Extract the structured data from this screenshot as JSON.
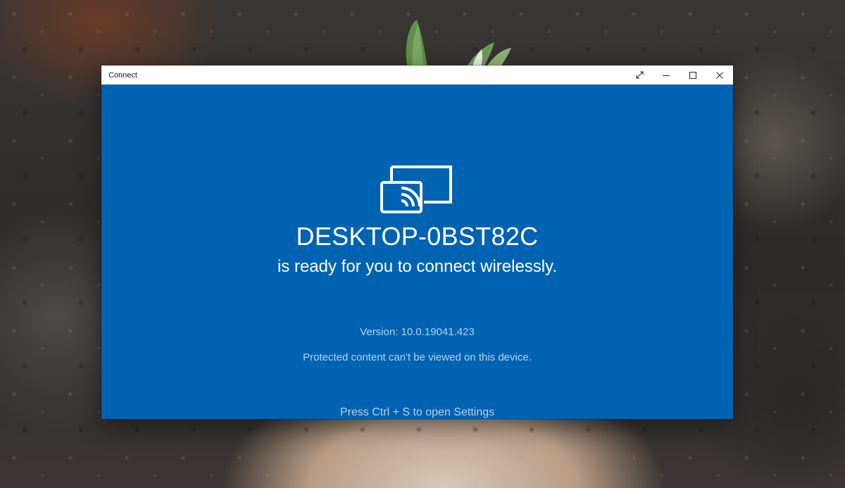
{
  "window": {
    "title": "Connect",
    "controls": {
      "fullscreen_icon": "expand-diagonal-icon",
      "minimize_icon": "minimize-icon",
      "maximize_icon": "maximize-icon",
      "close_icon": "close-icon"
    }
  },
  "main": {
    "icon": "cast-screen-icon",
    "device_name": "DESKTOP-0BST82C",
    "ready_message": "is ready for you to connect wirelessly.",
    "version": "Version: 10.0.19041.423",
    "protected_note": "Protected content can't be viewed on this device.",
    "settings_hint": "Press Ctrl + S to open Settings"
  },
  "colors": {
    "accent": "#0063b1",
    "titlebar": "#ffffff",
    "primary_text": "#ffffff",
    "secondary_text": "#b8d0e8"
  }
}
